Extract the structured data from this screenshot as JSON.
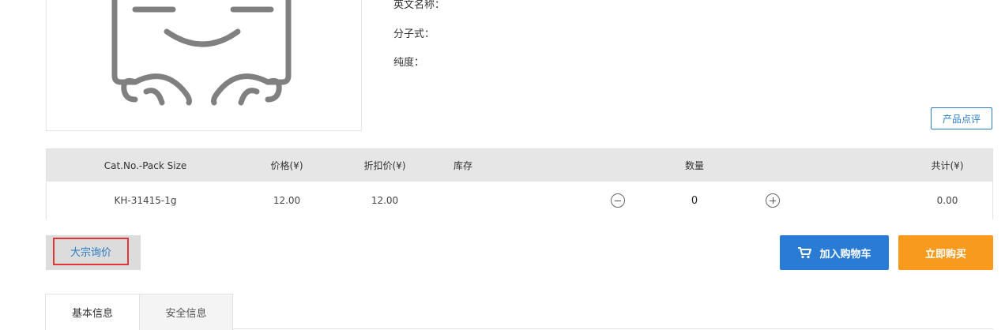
{
  "product": {
    "image_icon": "placeholder-face-icon",
    "fields": [
      {
        "label": "英文名称："
      },
      {
        "label": "分子式："
      },
      {
        "label": "纯度："
      }
    ],
    "review_button": "产品点评"
  },
  "table": {
    "headers": {
      "cat_no": "Cat.No.-Pack Size",
      "price": "价格(¥)",
      "discount": "折扣价(¥)",
      "stock": "库存",
      "quantity": "数量",
      "total": "共计(¥)"
    },
    "rows": [
      {
        "cat_no": "KH-31415-1g",
        "price": "12.00",
        "discount": "12.00",
        "stock": "",
        "quantity": "0",
        "total": "0.00"
      }
    ]
  },
  "actions": {
    "bulk_inquiry": "大宗询价",
    "add_to_cart": "加入购物车",
    "buy_now": "立即购买"
  },
  "tabs": [
    {
      "label": "基本信息",
      "active": true
    },
    {
      "label": "安全信息",
      "active": false
    }
  ],
  "colors": {
    "accent_blue": "#2a7bd4",
    "buy_orange": "#f79a1e",
    "highlight_red": "#e03636",
    "placeholder_gray": "#808080"
  }
}
